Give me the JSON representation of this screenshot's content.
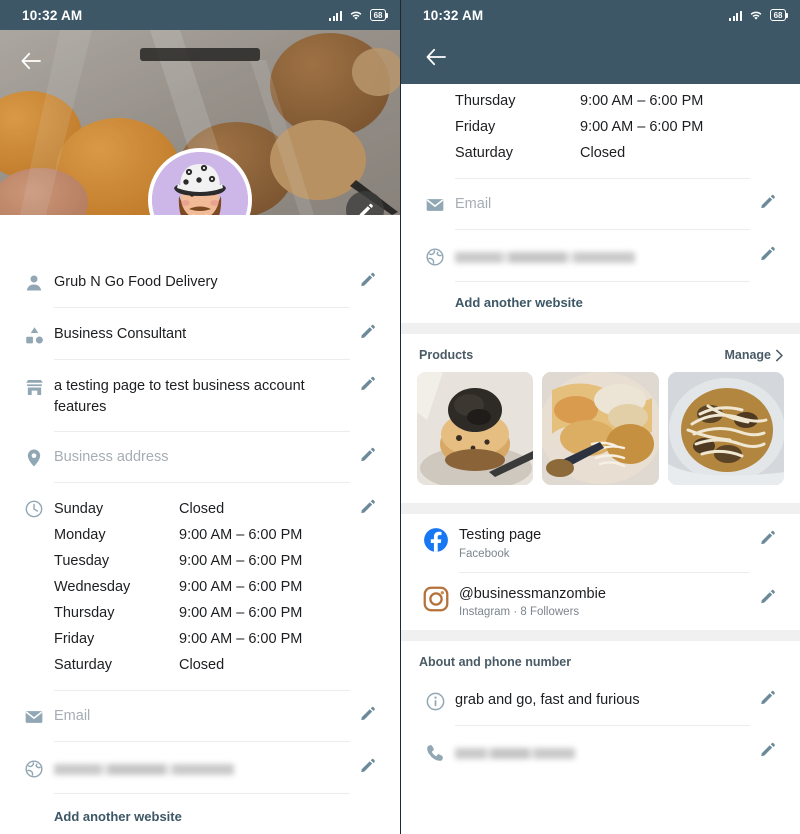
{
  "status_bar": {
    "time": "10:32 AM",
    "battery": "68",
    "signal_icon": "signal-bars-icon",
    "wifi_icon": "wifi-icon",
    "battery_icon": "battery-icon"
  },
  "colors": {
    "header": "#3d5766",
    "icon_slate": "#91a7b4",
    "text_primary": "#1c1e21",
    "text_placeholder": "#a6adb4",
    "divider": "#ececec",
    "band": "#f0f0f0",
    "facebook_blue": "#1877f2",
    "instagram_brown": "#b5713a",
    "avatar_bg": "#cdb6e8"
  },
  "left_screen": {
    "back_icon": "back-arrow-icon",
    "edit_cover_icon": "pencil-icon",
    "avatar_icon": "profile-avatar",
    "rows": [
      {
        "icon": "person-icon",
        "value": "Grub N Go Food Delivery",
        "placeholder": false
      },
      {
        "icon": "category-icon",
        "value": "Business Consultant",
        "placeholder": false
      },
      {
        "icon": "storefront-icon",
        "value": "a testing page to test business account features",
        "placeholder": false
      },
      {
        "icon": "location-pin-icon",
        "value": "Business address",
        "placeholder": true
      }
    ],
    "hours": {
      "icon": "clock-icon",
      "entries": [
        {
          "day": "Sunday",
          "value": "Closed"
        },
        {
          "day": "Monday",
          "value": "9:00 AM – 6:00 PM"
        },
        {
          "day": "Tuesday",
          "value": "9:00 AM – 6:00 PM"
        },
        {
          "day": "Wednesday",
          "value": "9:00 AM – 6:00 PM"
        },
        {
          "day": "Thursday",
          "value": "9:00 AM – 6:00 PM"
        },
        {
          "day": "Friday",
          "value": "9:00 AM – 6:00 PM"
        },
        {
          "day": "Saturday",
          "value": "Closed"
        }
      ]
    },
    "email_row": {
      "icon": "email-icon",
      "placeholder": "Email"
    },
    "website_row": {
      "icon": "globe-icon",
      "value_redacted": true
    },
    "add_website_label": "Add another website"
  },
  "right_screen": {
    "back_icon": "back-arrow-icon",
    "hours": [
      {
        "day": "Thursday",
        "value": "9:00 AM – 6:00 PM"
      },
      {
        "day": "Friday",
        "value": "9:00 AM – 6:00 PM"
      },
      {
        "day": "Saturday",
        "value": "Closed"
      }
    ],
    "email_row": {
      "icon": "email-icon",
      "placeholder": "Email"
    },
    "website_row": {
      "icon": "globe-icon",
      "value_redacted": true
    },
    "add_website_label": "Add another website",
    "products": {
      "title": "Products",
      "manage_label": "Manage",
      "chevron_icon": "chevron-right-icon",
      "items": [
        {
          "name": "product-thumb-1"
        },
        {
          "name": "product-thumb-2"
        },
        {
          "name": "product-thumb-3"
        }
      ]
    },
    "social": [
      {
        "icon": "facebook-icon",
        "title": "Testing page",
        "subtitle": "Facebook"
      },
      {
        "icon": "instagram-icon",
        "title": "@businessmanzombie",
        "subtitle": "Instagram · 8 Followers"
      }
    ],
    "about_section": {
      "label": "About and phone number",
      "about": {
        "icon": "info-icon",
        "value": "grab and go, fast and furious"
      },
      "phone": {
        "icon": "phone-icon",
        "value_redacted": true
      }
    }
  }
}
